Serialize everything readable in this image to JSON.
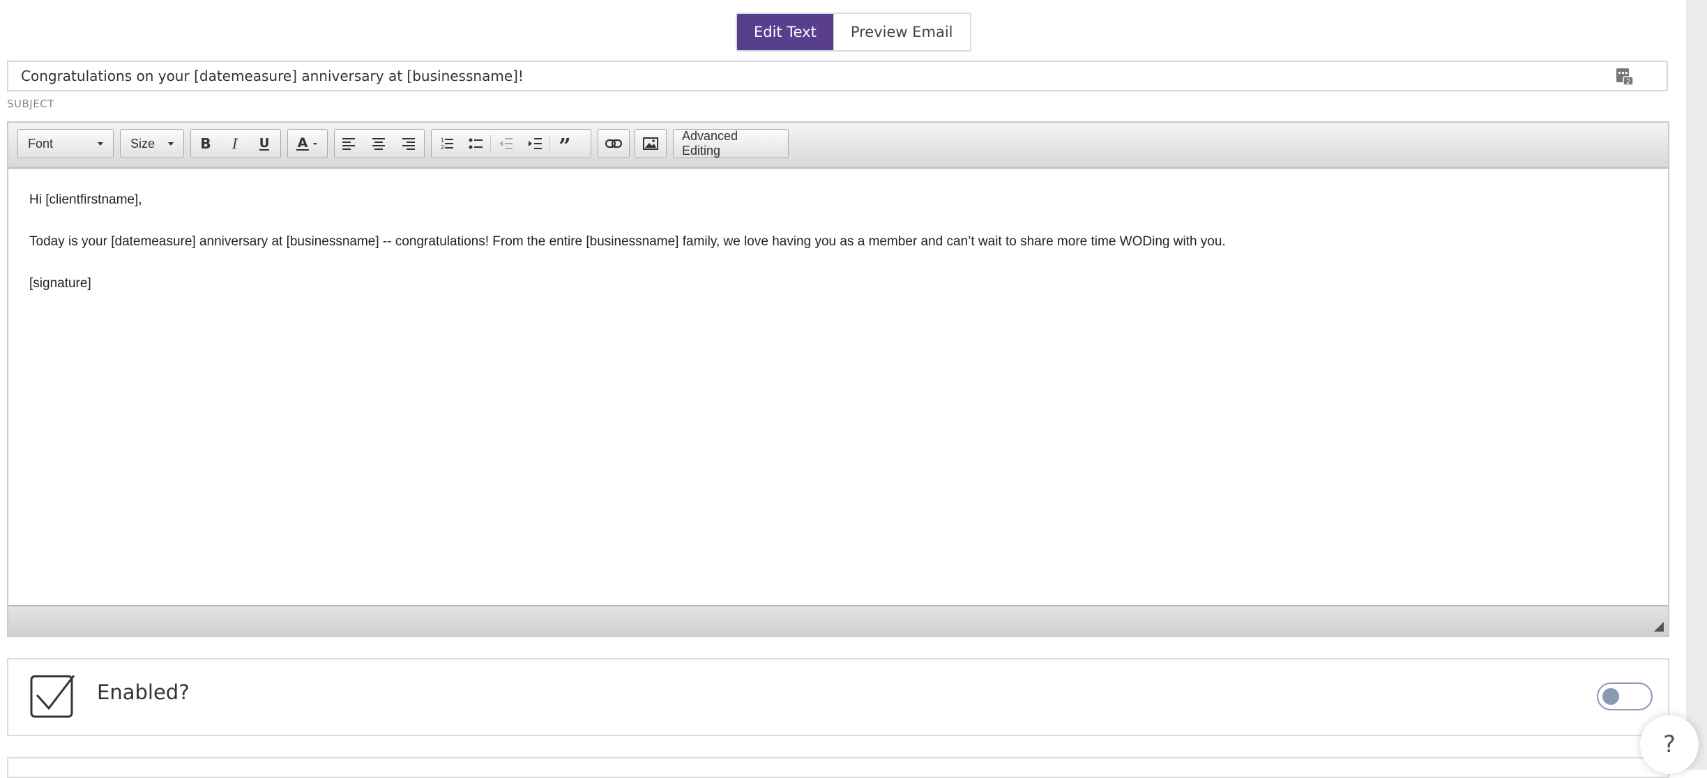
{
  "tabs": {
    "edit_text": "Edit Text",
    "preview_email": "Preview Email"
  },
  "subject": {
    "value": "Congratulations on your [datemeasure] anniversary at [businessname]!",
    "label": "SUBJECT",
    "merge_icon": "merge-field-icon"
  },
  "toolbar": {
    "font_label": "Font",
    "size_label": "Size",
    "advanced_label": "Advanced Editing",
    "icons": [
      "bold-icon",
      "italic-icon",
      "underline-icon",
      "text-color-icon",
      "align-left-icon",
      "align-center-icon",
      "align-right-icon",
      "numbered-list-icon",
      "bulleted-list-icon",
      "outdent-icon",
      "indent-icon",
      "blockquote-icon",
      "link-icon",
      "image-icon"
    ]
  },
  "body": {
    "greeting": "Hi [clientfirstname],",
    "message": "Today is your [datemeasure] anniversary at [businessname] -- congratulations! From the entire [businessname] family, we love having you as a member and can’t wait to share more time WODing with you.",
    "signature": "[signature]"
  },
  "enabled": {
    "label": "Enabled?",
    "toggle_on": false
  },
  "help": {
    "label": "?"
  },
  "colors": {
    "accent": "#5a3e8e",
    "toggle": "#8a9ab3"
  }
}
